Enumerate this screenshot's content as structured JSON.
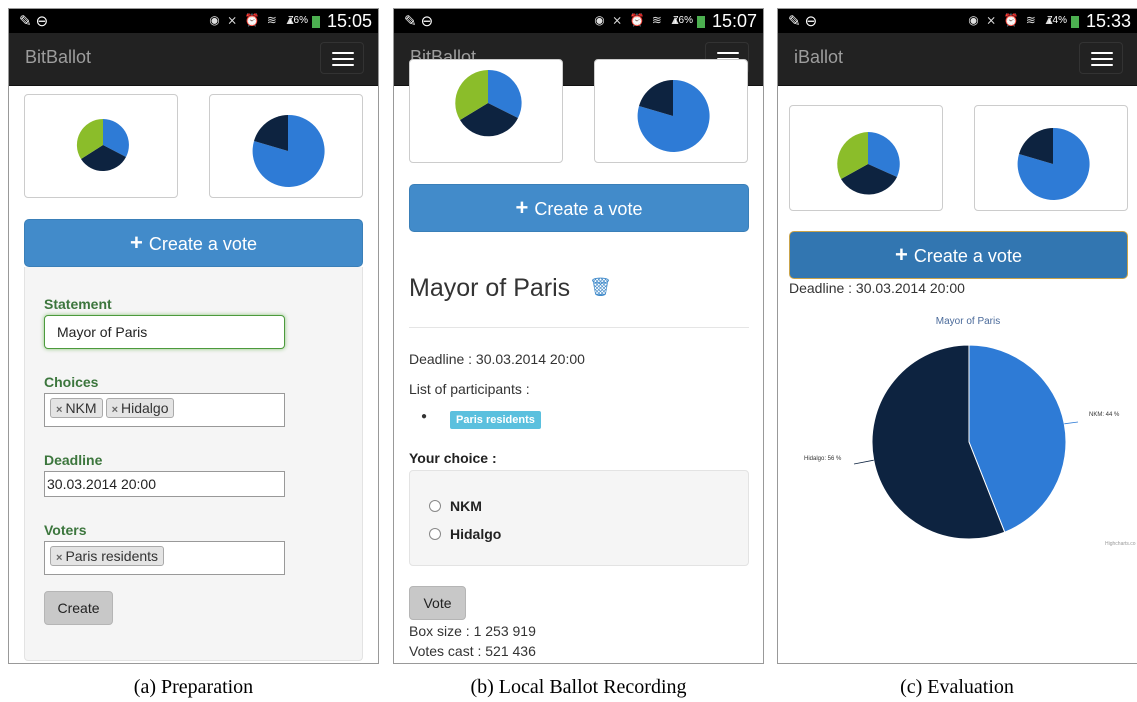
{
  "captions": [
    "(a) Preparation",
    "(b) Local Ballot Recording",
    "(c) Evaluation"
  ],
  "screens": [
    {
      "status_time": "15:05",
      "battery": "76%",
      "brand": "BitBallot",
      "create_label": "Create a vote",
      "form": {
        "statement_label": "Statement",
        "statement_value": "Mayor of Paris",
        "choices_label": "Choices",
        "choices": [
          "NKM",
          "Hidalgo"
        ],
        "deadline_label": "Deadline",
        "deadline_value": "30.03.2014 20:00",
        "voters_label": "Voters",
        "voters": [
          "Paris residents"
        ],
        "create_button": "Create"
      }
    },
    {
      "status_time": "15:07",
      "battery": "76%",
      "brand": "BitBallot",
      "create_label": "Create a vote",
      "vote": {
        "title": "Mayor of Paris",
        "deadline": "Deadline : 30.03.2014 20:00",
        "participants_label": "List of participants :",
        "participants": [
          "Paris residents"
        ],
        "your_choice_label": "Your choice :",
        "options": [
          "NKM",
          "Hidalgo"
        ],
        "vote_button": "Vote",
        "box_size": "Box size : 1 253 919",
        "votes_cast": "Votes cast : 521 436"
      }
    },
    {
      "status_time": "15:33",
      "battery": "74%",
      "brand": "iBallot",
      "create_label": "Create a vote",
      "deadline": "Deadline : 30.03.2014 20:00",
      "chart_credit": "Highcharts.co"
    }
  ],
  "chart_data": [
    {
      "type": "pie",
      "title": "Mayor of Paris",
      "categories": [
        "NKM",
        "Hidalgo"
      ],
      "values": [
        44,
        56
      ],
      "labels": [
        "NKM: 44 %",
        "Hidalgo: 56 %"
      ],
      "colors": [
        "#2e7bd6",
        "#0d2340"
      ]
    }
  ],
  "colors": {
    "navbar": "#222222",
    "primary": "#428bca",
    "label_green": "#3c763d",
    "tag_info": "#5bc0de",
    "pie_blue": "#2e7bd6",
    "pie_navy": "#0d2340",
    "pie_green": "#8bbd2a"
  },
  "icons": [
    "pencil-icon",
    "minus-circle-icon",
    "eye-icon",
    "mute-icon",
    "alarm-icon",
    "wifi-icon",
    "signal-icon",
    "battery-icon",
    "menu-icon",
    "plus-icon",
    "trash-icon",
    "close-icon"
  ]
}
